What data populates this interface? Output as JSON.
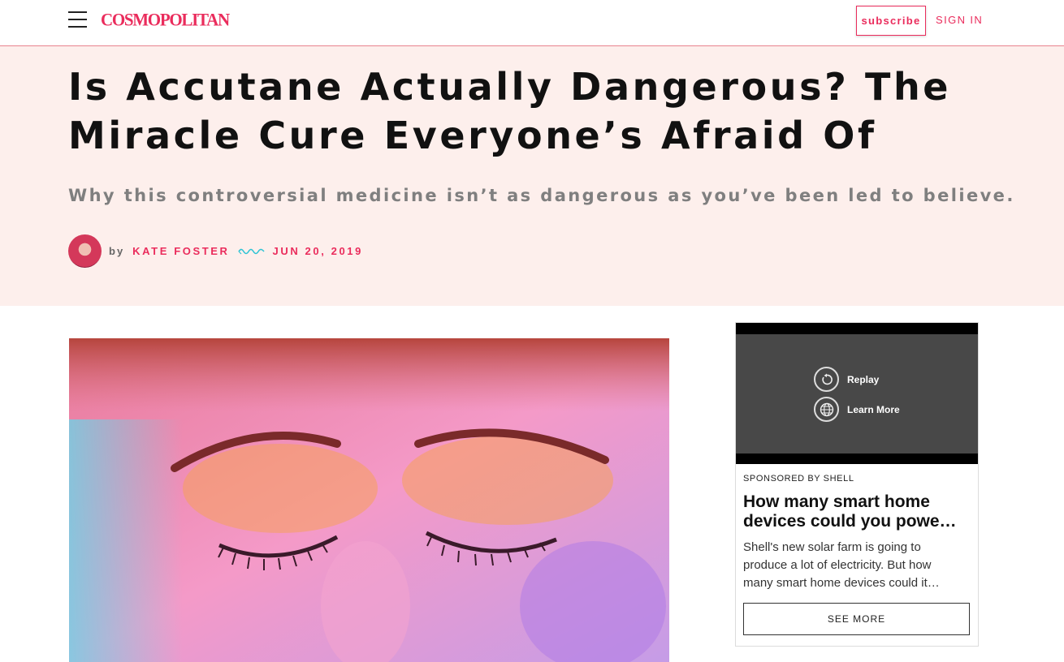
{
  "header": {
    "logo_text": "COSMOPOLITAN",
    "subscribe_label": "subscribe",
    "signin_label": "SIGN IN",
    "menu_icon": "hamburger-icon",
    "accent_color": "#ea2c5c"
  },
  "article": {
    "headline": "Is Accutane Actually Dangerous? The Miracle Cure Everyone’s Afraid Of",
    "dek": "Why this controversial medicine isn’t as dangerous as you’ve been led to believe.",
    "byline_prefix": "by",
    "author": "KATE FOSTER",
    "date": "JUN 20, 2019",
    "hero_background": "#fdefec"
  },
  "ad": {
    "replay_label": "Replay",
    "learn_more_label": "Learn More",
    "sponsor_label": "SPONSORED BY SHELL",
    "title": "How many smart home devices could you powe…",
    "body": "Shell's new solar farm is going to produce a lot of electricity. But how many smart home devices could it…",
    "cta_label": "SEE MORE"
  }
}
